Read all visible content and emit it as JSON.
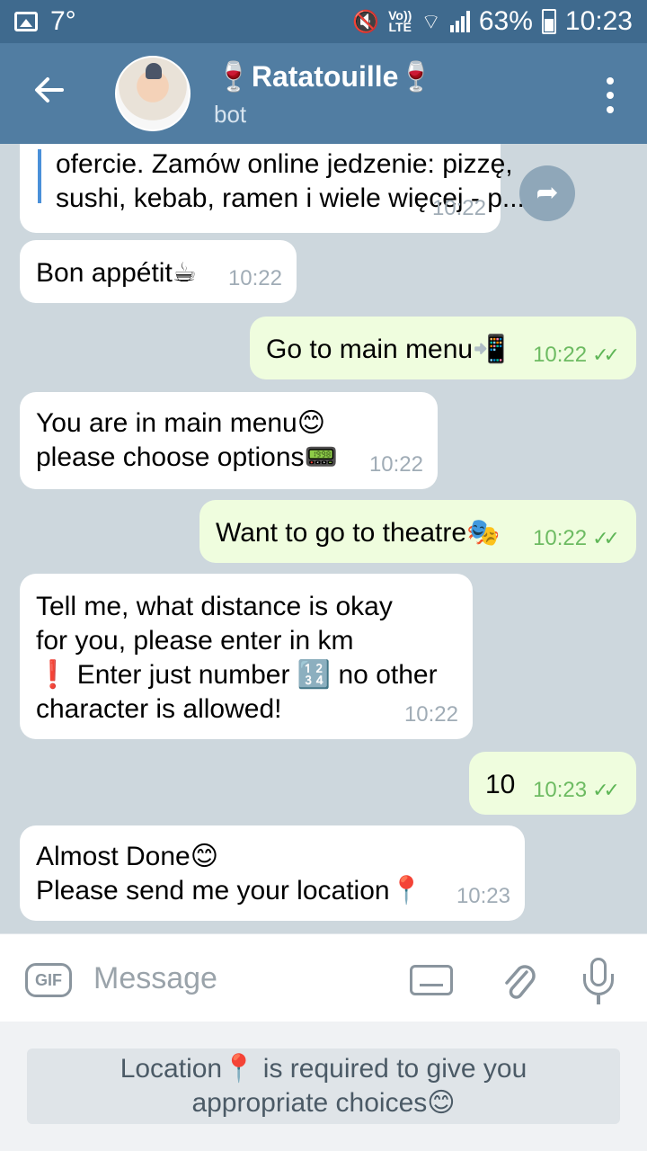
{
  "status_bar": {
    "temperature": "7°",
    "net_top": "Vo))",
    "net_bottom": "LTE",
    "battery": "63%",
    "time": "10:23"
  },
  "header": {
    "title": "🍷Ratatouille🍷",
    "subtitle": "bot"
  },
  "messages": [
    {
      "dir": "in",
      "lines": [
        "ofercie. Zamów online jedzenie: pizzę,",
        "sushi, kebab, ramen i wiele więcej - p..."
      ],
      "time": "10:22"
    },
    {
      "dir": "in",
      "lines": [
        "Bon appétit☕"
      ],
      "time": "10:22"
    },
    {
      "dir": "out",
      "lines": [
        "Go to main menu📲"
      ],
      "time": "10:22"
    },
    {
      "dir": "in",
      "lines": [
        "You are in main menu😊",
        "please choose options📟"
      ],
      "time": "10:22"
    },
    {
      "dir": "out",
      "lines": [
        "Want to go to theatre🎭"
      ],
      "time": "10:22"
    },
    {
      "dir": "in",
      "lines": [
        "Tell me, what distance is okay",
        "for you, please enter in km",
        "❗ Enter just number 🔢 no other",
        "character is allowed!"
      ],
      "time": "10:22"
    },
    {
      "dir": "out",
      "lines": [
        "10"
      ],
      "time": "10:23"
    },
    {
      "dir": "in",
      "lines": [
        "Almost Done😊",
        "Please send me your location📍"
      ],
      "time": "10:23"
    }
  ],
  "composer": {
    "gif_label": "GIF",
    "placeholder": "Message"
  },
  "reply_keyboard": {
    "button_line1": "Location📍 is required to give you",
    "button_line2": "appropriate choices😊"
  },
  "colors": {
    "header": "#517da2",
    "statusbar": "#3f6a8e",
    "incoming": "#ffffff",
    "outgoing": "#effdde",
    "time_out": "#6dbb62"
  },
  "icons": [
    "back-arrow-icon",
    "menu-dots-icon",
    "share-icon",
    "gif-icon",
    "keyboard-icon",
    "attach-icon",
    "microphone-icon"
  ]
}
